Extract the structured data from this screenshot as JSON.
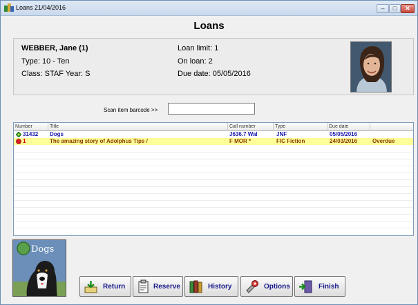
{
  "window": {
    "title": "Loans 21/04/2016"
  },
  "heading": "Loans",
  "borrower": {
    "name": "WEBBER, Jane  (1)",
    "type": "Type:  10 - Ten",
    "class_year": "Class: STAF  Year: S",
    "loan_limit": "Loan limit: 1",
    "on_loan": "On loan:  2",
    "due_date": "Due date:  05/05/2016"
  },
  "scan": {
    "label": "Scan item barcode >>",
    "value": ""
  },
  "table": {
    "columns": [
      "Number",
      "Title",
      "Call number",
      "Type",
      "Due date",
      ""
    ],
    "rows": [
      {
        "status_icon": "available-icon",
        "number": "31432",
        "title": "Dogs",
        "call_number": "J636.7 Wal",
        "type": "JNF",
        "due_date": "05/05/2016",
        "status": ""
      },
      {
        "status_icon": "overdue-icon",
        "number": "1",
        "title": "The amazing story of Adolphus Tips /",
        "call_number": "F  MOR *",
        "type": "FIC  Fiction",
        "due_date": "24/03/2016",
        "status": "Overdue"
      }
    ]
  },
  "cover": {
    "title": "Dogs"
  },
  "buttons": {
    "return": {
      "label": "Return",
      "icon": "return-icon"
    },
    "reserve": {
      "label": "Reserve",
      "icon": "reserve-icon"
    },
    "history": {
      "label": "History",
      "icon": "history-icon"
    },
    "options": {
      "label": "Options",
      "icon": "options-icon"
    },
    "finish": {
      "label": "Finish",
      "icon": "finish-icon"
    }
  },
  "colors": {
    "overdue_row": "#ffff99",
    "current_row_text": "#1a1ab0",
    "overdue_text": "#cc0000"
  }
}
